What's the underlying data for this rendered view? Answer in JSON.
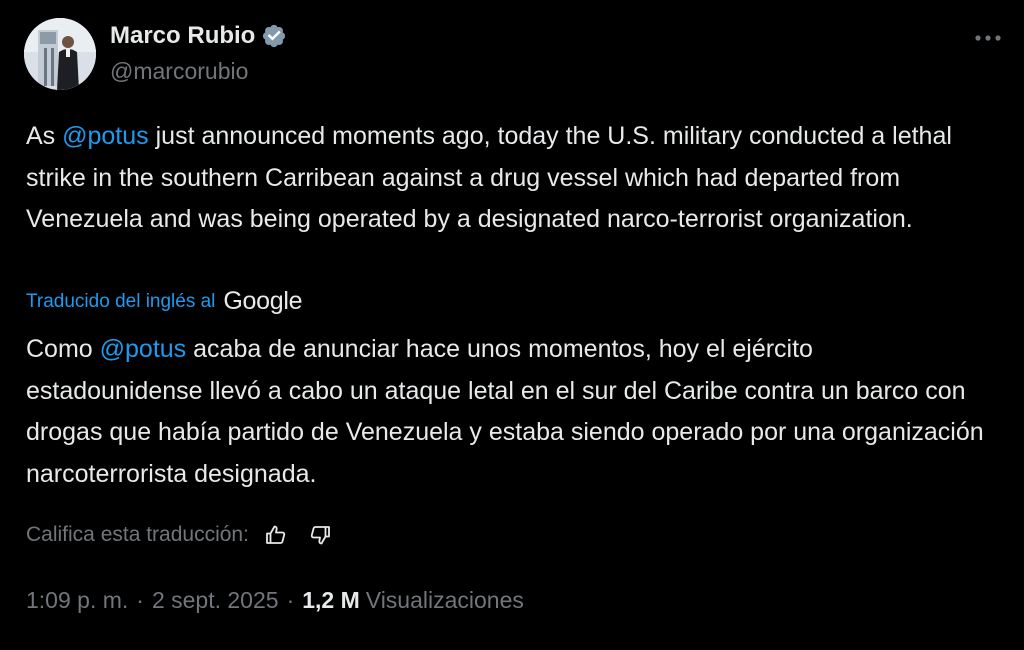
{
  "author": {
    "name": "Marco Rubio",
    "handle": "@marcorubio",
    "verified_icon": "verified-badge-icon"
  },
  "tweet": {
    "original": {
      "prefix": "As ",
      "mention": "@potus",
      "rest": " just announced moments ago, today the U.S. military conducted a lethal strike in the southern Carribean against a drug vessel which had departed from Venezuela and was being operated by a designated narco-terrorist organization."
    },
    "translated_by": {
      "label": "Traducido del inglés al",
      "provider": "Google"
    },
    "translation": {
      "prefix": "Como ",
      "mention": "@potus",
      "rest": " acaba de anunciar hace unos momentos, hoy el ejército estadounidense llevó a cabo un ataque letal en el sur del Caribe contra un barco con drogas que había partido de Venezuela y estaba siendo operado por una organización narcoterrorista designada."
    },
    "rate_label": "Califica esta traducción:",
    "time": "1:09 p. m.",
    "date": "2 sept. 2025",
    "separator": "·",
    "views_count": "1,2 M",
    "views_label": "Visualizaciones"
  },
  "icons": {
    "more": "more-options-icon",
    "thumbs_up": "thumbs-up-icon",
    "thumbs_down": "thumbs-down-icon"
  },
  "colors": {
    "background": "#000000",
    "text": "#e7e9ea",
    "secondary": "#71767b",
    "link": "#1d9bf0"
  }
}
